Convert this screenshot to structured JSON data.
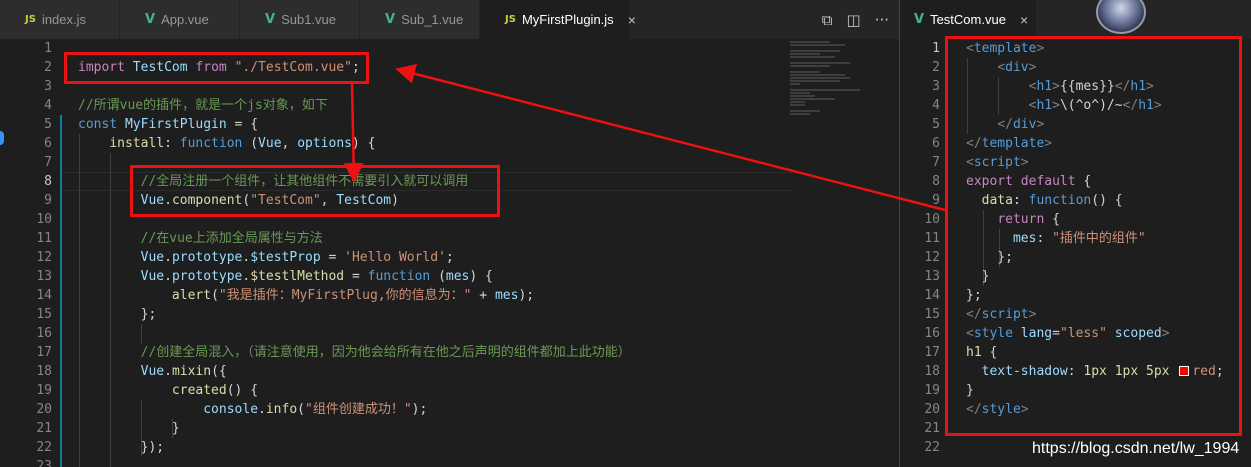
{
  "left_tabs": [
    {
      "icon": "JS",
      "label": "index.js"
    },
    {
      "icon": "V",
      "label": "App.vue"
    },
    {
      "icon": "V",
      "label": "Sub1.vue"
    },
    {
      "icon": "V",
      "label": "Sub_1.vue"
    },
    {
      "icon": "JS",
      "label": "MyFirstPlugin.js",
      "close": "×"
    }
  ],
  "editor_actions": {
    "compare": "⧉",
    "split": "◫",
    "more": "···"
  },
  "right_tab": {
    "icon": "V",
    "label": "TestCom.vue",
    "close": "×"
  },
  "left_lines": [
    {
      "n": "1",
      "parts": []
    },
    {
      "n": "2",
      "parts": [
        [
          "kc",
          "import "
        ],
        [
          "var",
          "TestCom "
        ],
        [
          "kc",
          "from "
        ],
        [
          "str",
          "\"./TestCom.vue\""
        ],
        [
          "txt",
          ";"
        ]
      ]
    },
    {
      "n": "3",
      "parts": []
    },
    {
      "n": "4",
      "parts": [
        [
          "cm",
          "//所谓vue的插件，就是一个js对象，如下"
        ]
      ]
    },
    {
      "n": "5",
      "parts": [
        [
          "kw",
          "const "
        ],
        [
          "var",
          "MyFirstPlugin "
        ],
        [
          "txt",
          "= {"
        ]
      ]
    },
    {
      "n": "6",
      "parts": [
        [
          "txt",
          "    "
        ],
        [
          "fn",
          "install"
        ],
        [
          "txt",
          ": "
        ],
        [
          "kw",
          "function "
        ],
        [
          "txt",
          "("
        ],
        [
          "var",
          "Vue"
        ],
        [
          "txt",
          ", "
        ],
        [
          "var",
          "options"
        ],
        [
          "txt",
          ") {"
        ]
      ]
    },
    {
      "n": "7",
      "parts": []
    },
    {
      "n": "8",
      "parts": [
        [
          "txt",
          "        "
        ],
        [
          "cm",
          "//全局注册一个组件，让其他组件不需要引入就可以调用"
        ]
      ]
    },
    {
      "n": "9",
      "parts": [
        [
          "txt",
          "        "
        ],
        [
          "var",
          "Vue"
        ],
        [
          "txt",
          "."
        ],
        [
          "fn",
          "component"
        ],
        [
          "txt",
          "("
        ],
        [
          "str",
          "\"TestCom\""
        ],
        [
          "txt",
          ", "
        ],
        [
          "var",
          "TestCom"
        ],
        [
          "txt",
          ")"
        ]
      ]
    },
    {
      "n": "10",
      "parts": []
    },
    {
      "n": "11",
      "parts": [
        [
          "txt",
          "        "
        ],
        [
          "cm",
          "//在vue上添加全局属性与方法"
        ]
      ]
    },
    {
      "n": "12",
      "parts": [
        [
          "txt",
          "        "
        ],
        [
          "var",
          "Vue"
        ],
        [
          "txt",
          "."
        ],
        [
          "var",
          "prototype"
        ],
        [
          "txt",
          "."
        ],
        [
          "var",
          "$testProp"
        ],
        [
          "txt",
          " = "
        ],
        [
          "str",
          "'Hello World'"
        ],
        [
          "txt",
          ";"
        ]
      ]
    },
    {
      "n": "13",
      "parts": [
        [
          "txt",
          "        "
        ],
        [
          "var",
          "Vue"
        ],
        [
          "txt",
          "."
        ],
        [
          "var",
          "prototype"
        ],
        [
          "txt",
          "."
        ],
        [
          "fn",
          "$testlMethod"
        ],
        [
          "txt",
          " = "
        ],
        [
          "kw",
          "function "
        ],
        [
          "txt",
          "("
        ],
        [
          "var",
          "mes"
        ],
        [
          "txt",
          ") {"
        ]
      ]
    },
    {
      "n": "14",
      "parts": [
        [
          "txt",
          "            "
        ],
        [
          "fn",
          "alert"
        ],
        [
          "txt",
          "("
        ],
        [
          "str",
          "\"我是插件：MyFirstPlug,你的信息为：\""
        ],
        [
          "txt",
          " + "
        ],
        [
          "var",
          "mes"
        ],
        [
          "txt",
          ");"
        ]
      ]
    },
    {
      "n": "15",
      "parts": [
        [
          "txt",
          "        };"
        ]
      ]
    },
    {
      "n": "16",
      "parts": []
    },
    {
      "n": "17",
      "parts": [
        [
          "txt",
          "        "
        ],
        [
          "cm",
          "//创建全局混入，（请注意使用，因为他会给所有在他之后声明的组件都加上此功能）"
        ]
      ]
    },
    {
      "n": "18",
      "parts": [
        [
          "txt",
          "        "
        ],
        [
          "var",
          "Vue"
        ],
        [
          "txt",
          "."
        ],
        [
          "fn",
          "mixin"
        ],
        [
          "txt",
          "({"
        ]
      ]
    },
    {
      "n": "19",
      "parts": [
        [
          "txt",
          "            "
        ],
        [
          "fn",
          "created"
        ],
        [
          "txt",
          "() {"
        ]
      ]
    },
    {
      "n": "20",
      "parts": [
        [
          "txt",
          "                "
        ],
        [
          "var",
          "console"
        ],
        [
          "txt",
          "."
        ],
        [
          "fn",
          "info"
        ],
        [
          "txt",
          "("
        ],
        [
          "str",
          "\"组件创建成功！\""
        ],
        [
          "txt",
          ");"
        ]
      ]
    },
    {
      "n": "21",
      "parts": [
        [
          "txt",
          "            }"
        ]
      ]
    },
    {
      "n": "22",
      "parts": [
        [
          "txt",
          "        });"
        ]
      ]
    },
    {
      "n": "23",
      "parts": []
    }
  ],
  "right_lines": [
    {
      "n": "1",
      "parts": [
        [
          "pun",
          "<"
        ],
        [
          "tag",
          "template"
        ],
        [
          "pun",
          ">"
        ]
      ]
    },
    {
      "n": "2",
      "parts": [
        [
          "txt",
          "    "
        ],
        [
          "pun",
          "<"
        ],
        [
          "tag",
          "div"
        ],
        [
          "pun",
          ">"
        ]
      ]
    },
    {
      "n": "3",
      "parts": [
        [
          "txt",
          "        "
        ],
        [
          "pun",
          "<"
        ],
        [
          "tag",
          "h1"
        ],
        [
          "pun",
          ">"
        ],
        [
          "txt",
          "{{mes}}"
        ],
        [
          "pun",
          "</"
        ],
        [
          "tag",
          "h1"
        ],
        [
          "pun",
          ">"
        ]
      ]
    },
    {
      "n": "4",
      "parts": [
        [
          "txt",
          "        "
        ],
        [
          "pun",
          "<"
        ],
        [
          "tag",
          "h1"
        ],
        [
          "pun",
          ">"
        ],
        [
          "txt",
          "\\(^o^)/~"
        ],
        [
          "pun",
          "</"
        ],
        [
          "tag",
          "h1"
        ],
        [
          "pun",
          ">"
        ]
      ]
    },
    {
      "n": "5",
      "parts": [
        [
          "txt",
          "    "
        ],
        [
          "pun",
          "</"
        ],
        [
          "tag",
          "div"
        ],
        [
          "pun",
          ">"
        ]
      ]
    },
    {
      "n": "6",
      "parts": [
        [
          "pun",
          "</"
        ],
        [
          "tag",
          "template"
        ],
        [
          "pun",
          ">"
        ]
      ]
    },
    {
      "n": "7",
      "parts": [
        [
          "pun",
          "<"
        ],
        [
          "tag",
          "script"
        ],
        [
          "pun",
          ">"
        ]
      ]
    },
    {
      "n": "8",
      "parts": [
        [
          "kc",
          "export "
        ],
        [
          "kc",
          "default "
        ],
        [
          "txt",
          "{"
        ]
      ]
    },
    {
      "n": "9",
      "parts": [
        [
          "txt",
          "  "
        ],
        [
          "fn",
          "data"
        ],
        [
          "txt",
          ": "
        ],
        [
          "kw",
          "function"
        ],
        [
          "txt",
          "() {"
        ]
      ]
    },
    {
      "n": "10",
      "parts": [
        [
          "txt",
          "    "
        ],
        [
          "kc",
          "return "
        ],
        [
          "txt",
          "{"
        ]
      ]
    },
    {
      "n": "11",
      "parts": [
        [
          "txt",
          "      "
        ],
        [
          "var",
          "mes"
        ],
        [
          "txt",
          ": "
        ],
        [
          "str",
          "\"插件中的组件\""
        ]
      ]
    },
    {
      "n": "12",
      "parts": [
        [
          "txt",
          "    };"
        ]
      ]
    },
    {
      "n": "13",
      "parts": [
        [
          "txt",
          "  }"
        ]
      ]
    },
    {
      "n": "14",
      "parts": [
        [
          "txt",
          "};"
        ]
      ]
    },
    {
      "n": "15",
      "parts": [
        [
          "pun",
          "</"
        ],
        [
          "tag",
          "script"
        ],
        [
          "pun",
          ">"
        ]
      ]
    },
    {
      "n": "16",
      "parts": [
        [
          "pun",
          "<"
        ],
        [
          "tag",
          "style "
        ],
        [
          "attr",
          "lang"
        ],
        [
          "txt",
          "="
        ],
        [
          "str",
          "\"less\" "
        ],
        [
          "attr",
          "scoped"
        ],
        [
          "pun",
          ">"
        ]
      ]
    },
    {
      "n": "17",
      "parts": [
        [
          "fn",
          "h1 "
        ],
        [
          "txt",
          "{"
        ]
      ]
    },
    {
      "n": "18",
      "parts": [
        [
          "txt",
          "  "
        ],
        [
          "var",
          "text-shadow"
        ],
        [
          "txt",
          ": "
        ],
        [
          "fn",
          "1px 1px 5px "
        ],
        [
          "swatch",
          ""
        ],
        [
          "str",
          "red"
        ],
        [
          "txt",
          ";"
        ]
      ]
    },
    {
      "n": "19",
      "parts": [
        [
          "txt",
          "}"
        ]
      ]
    },
    {
      "n": "20",
      "parts": [
        [
          "pun",
          "</"
        ],
        [
          "tag",
          "style"
        ],
        [
          "pun",
          ">"
        ]
      ]
    },
    {
      "n": "21",
      "parts": []
    },
    {
      "n": "22",
      "parts": []
    }
  ],
  "colors": {
    "annotation": "#ee1111",
    "vue_icon": "#41b883",
    "js_icon": "#cbcb41"
  },
  "watermark": "https://blog.csdn.net/lw_1994"
}
